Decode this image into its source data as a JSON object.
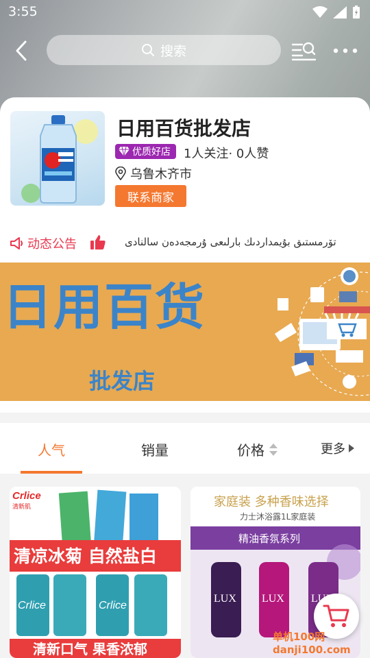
{
  "status_bar": {
    "time": "3:55"
  },
  "nav": {
    "search_placeholder": "搜索"
  },
  "store": {
    "name": "日用百货批发店",
    "badge": "优质好店",
    "stats": "1人关注· 0人赞",
    "location": "乌鲁木齐市",
    "contact_label": "联系商家"
  },
  "notice": {
    "label": "动态公告",
    "text": "تۆرمستىق بۇيمداردىك بارلىعى ۇرمجەدەن سالنادى"
  },
  "banner": {
    "title": "日用百货",
    "subtitle": "批发店"
  },
  "tabs": [
    {
      "label": "人气",
      "active": true
    },
    {
      "label": "销量",
      "active": false
    },
    {
      "label": "价格",
      "active": false
    },
    {
      "label": "更多",
      "active": false
    }
  ],
  "products": [
    {
      "brand": "Crlice",
      "brand_cn": "清新肌",
      "top_text": "清凉冰菊  自然盐白",
      "bottom_text": "清新口气 果香浓郁"
    },
    {
      "headline": "家庭装 多种香味选择",
      "subline": "力士沐浴露1L家庭装",
      "band": "精油香氛系列",
      "brand": "LUX"
    }
  ],
  "colors": {
    "accent": "#f47830",
    "notice": "#e8394f",
    "badge": "#9c27b0",
    "banner_bg": "#e8a951",
    "banner_text": "#3b84c9"
  },
  "watermark": "单机100网 danji100.com"
}
